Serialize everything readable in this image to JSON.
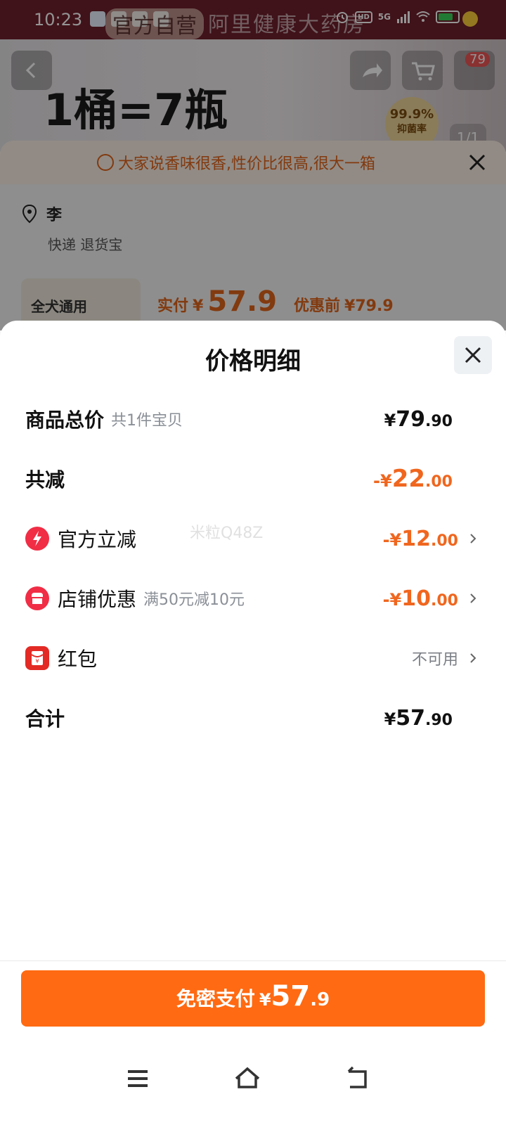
{
  "status_bar": {
    "time": "10:23",
    "network": "5G",
    "hd_label": "HD"
  },
  "background": {
    "brand_banner": "阿里健康大药房",
    "banner_tag": "官方自营",
    "headline": "1桶=7瓶",
    "badge_value": "99.9%",
    "badge_text": "抑菌率",
    "page_indicator": "1/1",
    "cart_count": "79",
    "notice": "大家说香味很香,性价比很高,很大一箱",
    "address_name": "李",
    "delivery_text": "快递  退货宝",
    "thumb_text": "全犬通用",
    "pay_label": "实付",
    "pay_symbol": "¥",
    "pay_amount": "57.9",
    "original_label": "优惠前",
    "original_amount": "¥79.9"
  },
  "sheet": {
    "title": "价格明细",
    "rows": {
      "total": {
        "label": "商品总价",
        "sub": "共1件宝贝",
        "symbol": "¥",
        "int": "79",
        "dec": ".90"
      },
      "reduce": {
        "label": "共减",
        "symbol": "-¥",
        "int": "22",
        "dec": ".00"
      },
      "official": {
        "label": "官方立减",
        "symbol": "-¥",
        "int": "12",
        "dec": ".00"
      },
      "shop": {
        "label": "店铺优惠",
        "sub": "满50元减10元",
        "symbol": "-¥",
        "int": "10",
        "dec": ".00"
      },
      "redpacket": {
        "label": "红包",
        "status": "不可用"
      },
      "sum": {
        "label": "合计",
        "symbol": "¥",
        "int": "57",
        "dec": ".90"
      }
    },
    "watermark": "米粒Q48Z"
  },
  "pay_button": {
    "label": "免密支付",
    "symbol": "¥",
    "int": "57",
    "dec": ".9"
  },
  "colors": {
    "accent": "#ff6a12",
    "discount": "#f0661e",
    "icon_red": "#f02d45"
  }
}
